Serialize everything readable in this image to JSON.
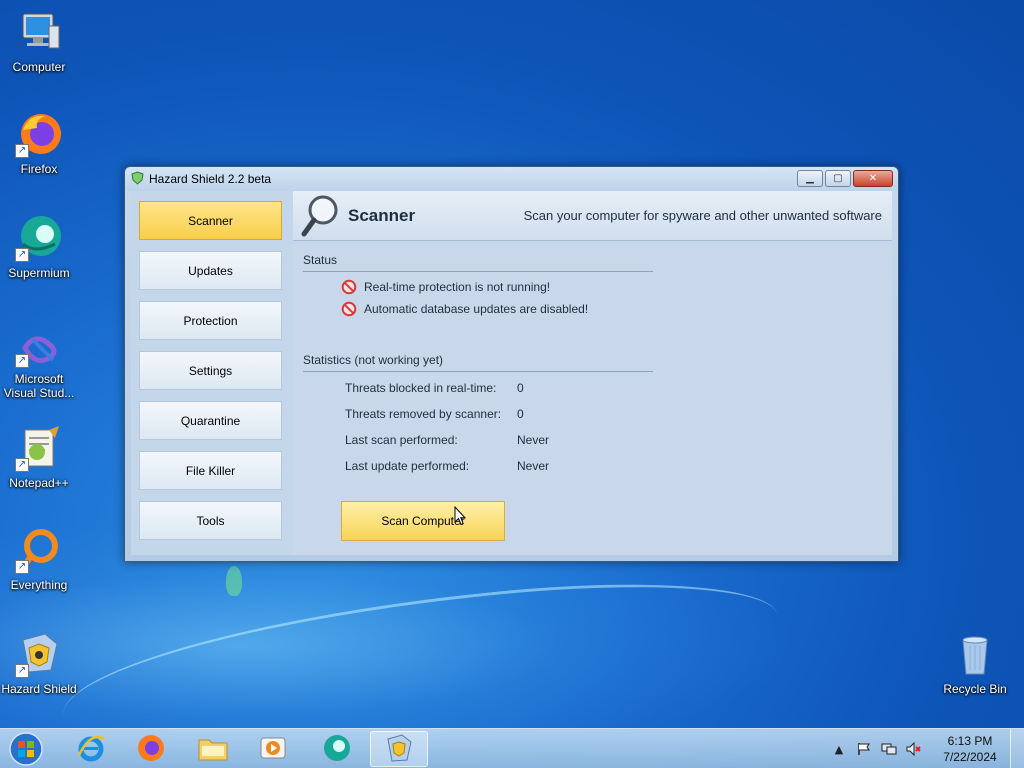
{
  "desktop": {
    "icons": [
      {
        "label": "Computer",
        "icon": "computer-icon"
      },
      {
        "label": "Firefox",
        "icon": "firefox-icon"
      },
      {
        "label": "Supermium",
        "icon": "supermium-icon"
      },
      {
        "label": "Microsoft Visual Stud...",
        "icon": "visual-studio-icon"
      },
      {
        "label": "Notepad++",
        "icon": "notepad-plus-plus-icon"
      },
      {
        "label": "Everything",
        "icon": "everything-icon"
      },
      {
        "label": "Hazard Shield",
        "icon": "hazard-shield-icon"
      },
      {
        "label": "Recycle Bin",
        "icon": "recycle-bin-icon"
      }
    ]
  },
  "window": {
    "title": "Hazard Shield 2.2 beta",
    "nav": [
      {
        "label": "Scanner",
        "active": true
      },
      {
        "label": "Updates"
      },
      {
        "label": "Protection"
      },
      {
        "label": "Settings"
      },
      {
        "label": "Quarantine"
      },
      {
        "label": "File Killer"
      },
      {
        "label": "Tools"
      }
    ],
    "header": {
      "title": "Scanner",
      "description": "Scan your computer for spyware and other unwanted software"
    },
    "status": {
      "title": "Status",
      "items": [
        "Real-time protection is not running!",
        "Automatic database updates are disabled!"
      ]
    },
    "statistics": {
      "title": "Statistics (not working yet)",
      "rows": [
        {
          "label": "Threats blocked in real-time:",
          "value": "0"
        },
        {
          "label": "Threats removed by scanner:",
          "value": "0"
        },
        {
          "label": "Last scan performed:",
          "value": "Never"
        },
        {
          "label": "Last update performed:",
          "value": "Never"
        }
      ]
    },
    "scan_button": "Scan Computer"
  },
  "taskbar": {
    "clock_time": "6:13 PM",
    "clock_date": "7/22/2024"
  },
  "colors": {
    "active_nav": "#f8cf4a",
    "scan_button": "#f7d457",
    "desktop_blue": "#1a6ccf"
  }
}
